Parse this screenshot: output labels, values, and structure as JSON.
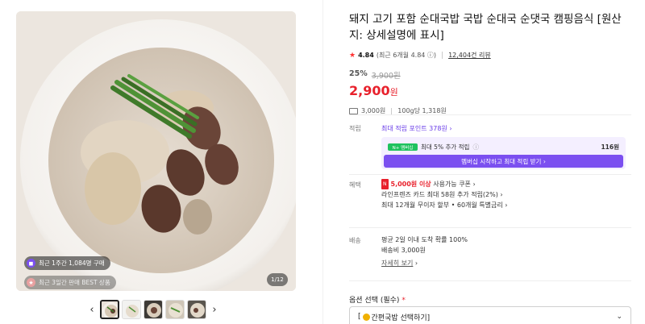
{
  "gallery": {
    "pill_weekly": "최근 1주간 1,084명 구매",
    "pill_best": "최근 3일간 판매 BEST 상품",
    "counter": "1/12",
    "prev_icon": "chevron-left-icon",
    "next_icon": "chevron-right-icon",
    "thumb_count": 5
  },
  "product": {
    "title": "돼지 고기 포함 순대국밥 국밥 순대국 순댓국 캠핑음식 [원산지: 상세설명에 표시]",
    "rating_score": "4.84",
    "rating_recent": "(최근 6개월 4.84",
    "reviews": "12,404건 리뷰",
    "discount": "25%",
    "original_price": "3,900원",
    "price": "2,900",
    "price_unit": "원",
    "shipping_price": "3,000원",
    "unit_price": "100g당 1,318원"
  },
  "points": {
    "label": "적립",
    "max_points": "최대 적립 포인트 378원",
    "membership_text": "최대 5% 추가 적립",
    "membership_badge": "N+ 멤버십",
    "membership_points": "116원",
    "membership_button": "멤버십 시작하고 최대 적립 받기"
  },
  "benefits": {
    "label": "혜택",
    "coupon_prefix": "N",
    "coupon_amount": "5,000원 이상",
    "coupon_text": "사용가능 쿠폰",
    "card": "라인프렌즈 카드 최대 58원 추가 적립(2%)",
    "installment": "최대 12개월 무이자 할부 • 60개월 특별금리"
  },
  "delivery": {
    "label": "배송",
    "arrival": "평균 2일 이내 도착 확률 100%",
    "fee": "배송비 3,000원",
    "details": "자세히 보기"
  },
  "option": {
    "label": "옵션 선택 (필수)",
    "required_mark": "*",
    "select_prefix": "[",
    "select_text": "간편국밥 선택하기]"
  },
  "colors": {
    "accent_red": "#e8212c",
    "purple": "#7b4ff0",
    "naver_green": "#1fc25e"
  }
}
